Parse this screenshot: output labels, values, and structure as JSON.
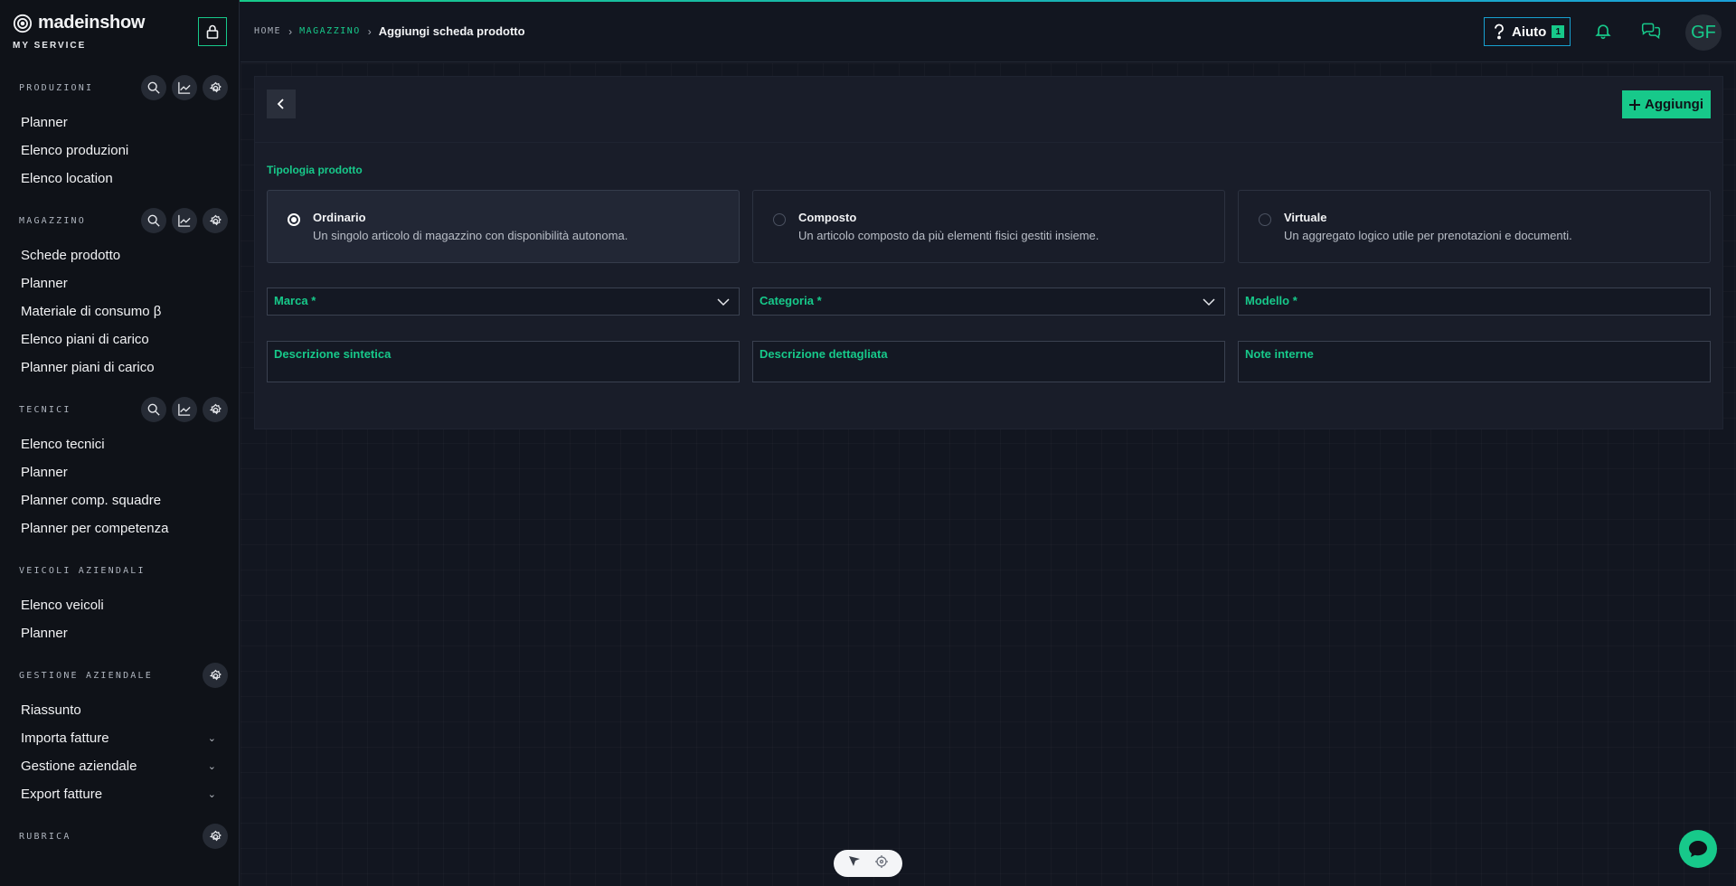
{
  "brand": {
    "name": "madeinshow",
    "subtitle": "MY SERVICE"
  },
  "breadcrumb": {
    "home": "HOME",
    "section": "MAGAZZINO",
    "current": "Aggiungi scheda prodotto"
  },
  "header": {
    "help_label": "Aiuto",
    "help_badge": "1",
    "avatar_initials": "GF"
  },
  "sidebar": {
    "produzioni": {
      "title": "PRODUZIONI",
      "items": [
        "Planner",
        "Elenco produzioni",
        "Elenco location"
      ]
    },
    "magazzino": {
      "title": "MAGAZZINO",
      "items": [
        "Schede prodotto",
        "Planner",
        "Materiale di consumo β",
        "Elenco piani di carico",
        "Planner piani di carico"
      ]
    },
    "tecnici": {
      "title": "TECNICI",
      "items": [
        "Elenco tecnici",
        "Planner",
        "Planner comp. squadre",
        "Planner per competenza"
      ]
    },
    "veicoli": {
      "title": "VEICOLI AZIENDALI",
      "items": [
        "Elenco veicoli",
        "Planner"
      ]
    },
    "gestione": {
      "title": "GESTIONE AZIENDALE",
      "items": [
        "Riassunto",
        "Importa fatture",
        "Gestione aziendale",
        "Export fatture"
      ]
    },
    "rubrica": {
      "title": "RUBRICA"
    }
  },
  "form": {
    "add_label": "Aggiungi",
    "type_section_label": "Tipologia prodotto",
    "types": [
      {
        "title": "Ordinario",
        "desc": "Un singolo articolo di magazzino con disponibilità autonoma."
      },
      {
        "title": "Composto",
        "desc": "Un articolo composto da più elementi fisici gestiti insieme."
      },
      {
        "title": "Virtuale",
        "desc": "Un aggregato logico utile per prenotazioni e documenti."
      }
    ],
    "selected_type": "Ordinario",
    "fields": {
      "marca": "Marca *",
      "categoria": "Categoria *",
      "modello": "Modello *",
      "descrizione_sintetica": "Descrizione sintetica",
      "descrizione_dettagliata": "Descrizione dettagliata",
      "note_interne": "Note interne"
    }
  },
  "colors": {
    "accent": "#17c98a",
    "help_border": "#17a0d0",
    "background": "#121620",
    "panel": "#191d29"
  }
}
